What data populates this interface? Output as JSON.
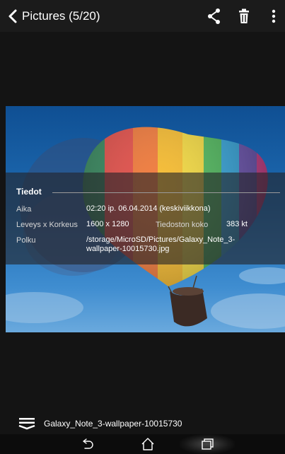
{
  "header": {
    "title": "Pictures (5/20)",
    "actions": [
      "back-icon",
      "share-icon",
      "delete-icon",
      "overflow-menu-icon"
    ]
  },
  "photo": {
    "subject": "hot-air-balloon"
  },
  "details": {
    "heading": "Tiedot",
    "time_label": "Aika",
    "time_value": "02:20 ip. 06.04.2014 (keskiviikkona)",
    "dimensions_label": "Leveys x Korkeus",
    "dimensions_value": "1600 x 1280",
    "size_label": "Tiedoston koko",
    "size_value": "383 kt",
    "path_label": "Polku",
    "path_line1": "/storage/MicroSD/Pictures/Galaxy_Note_3-",
    "path_line2": "wallpaper-10015730.jpg"
  },
  "footer": {
    "filename": "Galaxy_Note_3-wallpaper-10015730"
  },
  "navbar": {
    "buttons": [
      "back-nav-icon",
      "home-icon",
      "recent-apps-icon"
    ]
  }
}
